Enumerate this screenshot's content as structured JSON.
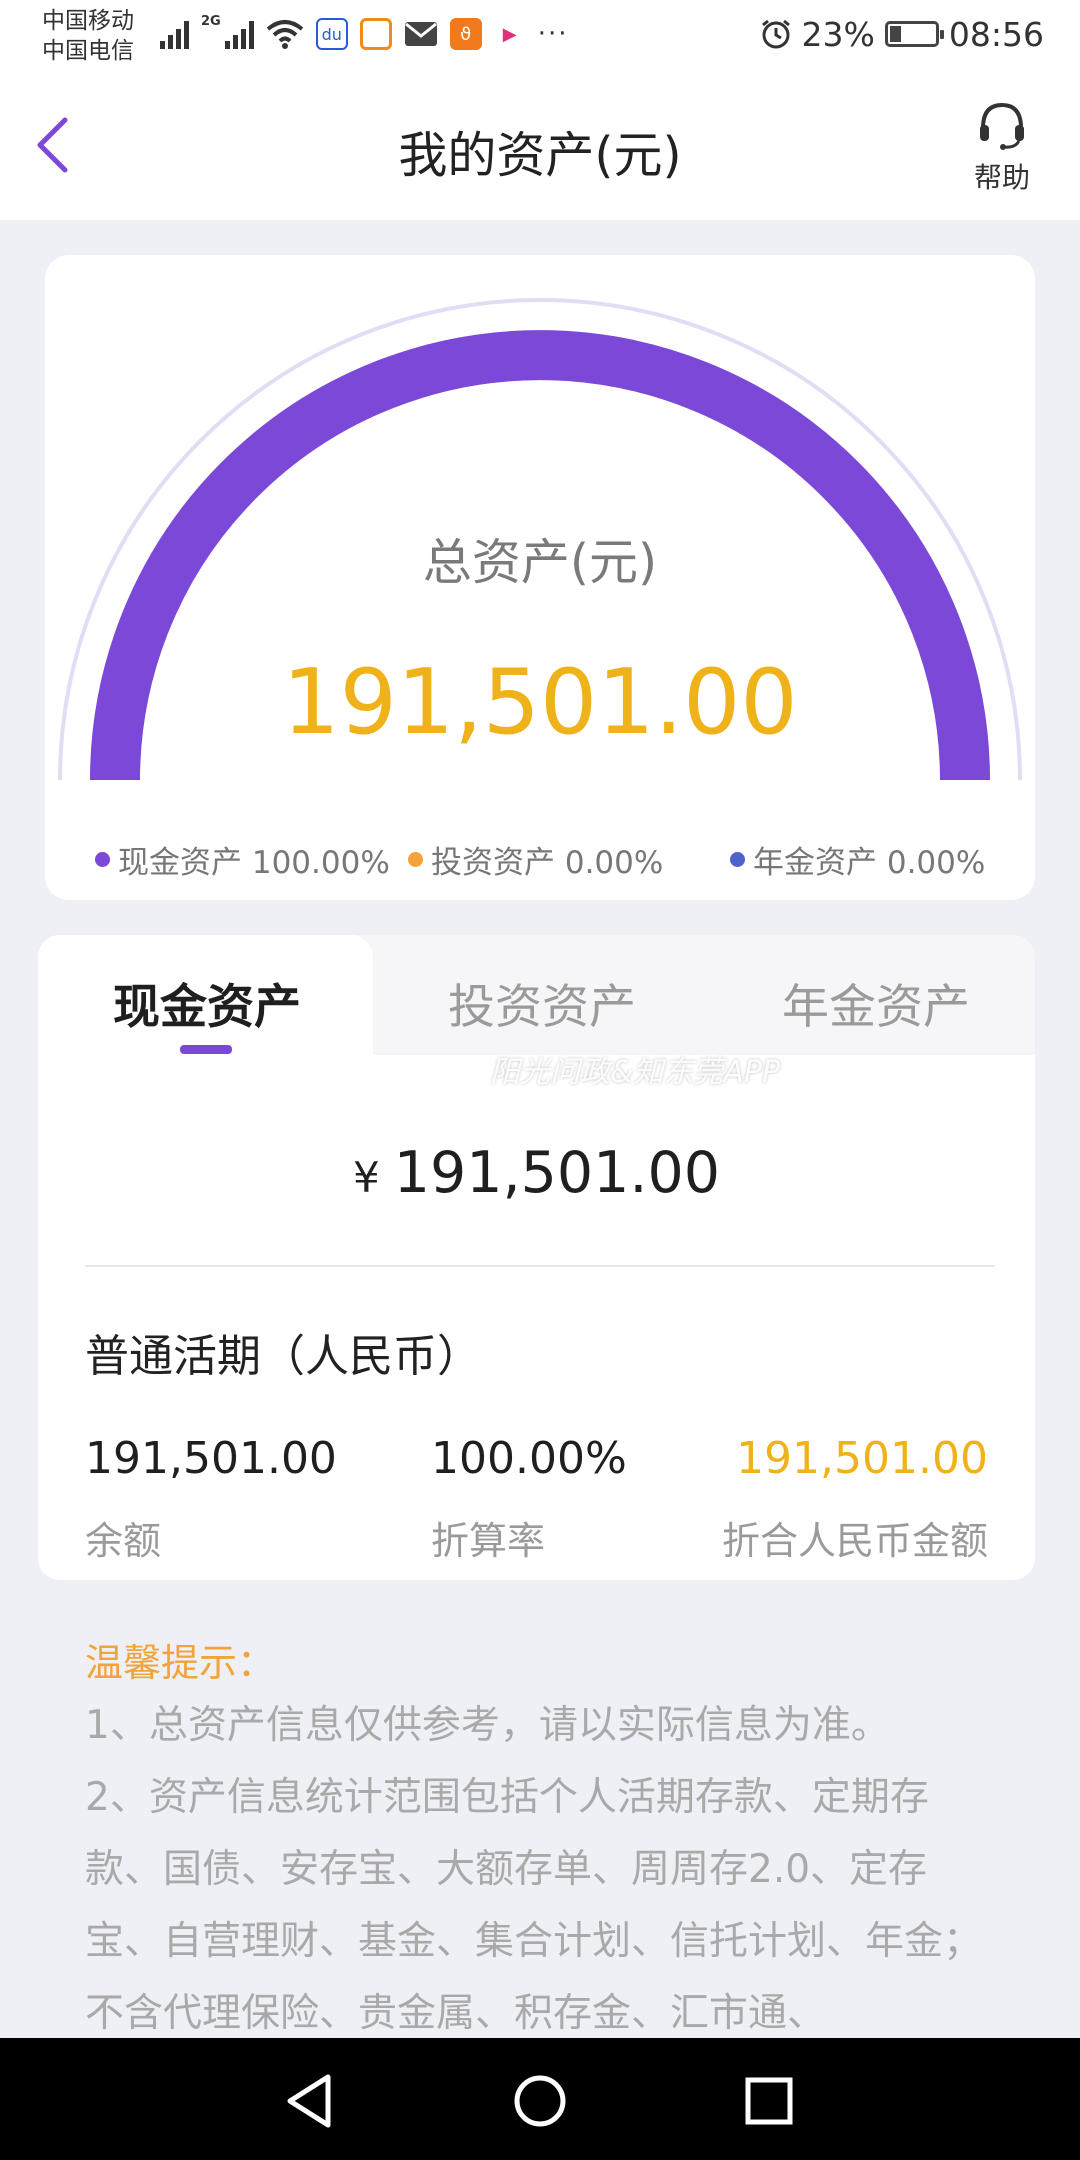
{
  "status_bar": {
    "carrier1": "中国移动",
    "carrier2": "中国电信",
    "signal_label": "2G",
    "battery": "23%",
    "time": "08:56"
  },
  "header": {
    "title": "我的资产(元)",
    "help_label": "帮助"
  },
  "gauge": {
    "label": "总资产(元)",
    "value": "191,501.00",
    "cash_fraction": 1.0,
    "legend": [
      {
        "label": "现金资产 100.00%",
        "color": "#7c48d8"
      },
      {
        "label": "投资资产 0.00%",
        "color": "#f2a33a"
      },
      {
        "label": "年金资产 0.00%",
        "color": "#4f62c9"
      }
    ]
  },
  "tabs": [
    {
      "label": "现金资产",
      "active": true
    },
    {
      "label": "投资资产",
      "active": false
    },
    {
      "label": "年金资产",
      "active": false
    }
  ],
  "watermark": "阳光问政&知东莞APP",
  "detail": {
    "currency_symbol": "¥",
    "total": "191,501.00",
    "account_title": "普通活期（人民币）",
    "balance_value": "191,501.00",
    "balance_label": "余额",
    "rate_value": "100.00%",
    "rate_label": "折算率",
    "rmb_value": "191,501.00",
    "rmb_label": "折合人民币金额"
  },
  "tips": {
    "title": "温馨提示：",
    "lines": [
      "1、总资产信息仅供参考，请以实际信息为准。",
      "2、资产信息统计范围包括个人活期存款、定期存款、国债、安存宝、大额存单、周周存2.0、定存宝、自营理财、基金、集合计划、信托计划、年金；不含代理保险、贵金属、积存金、汇市通、"
    ]
  },
  "colors": {
    "accent": "#7c48d8",
    "gold": "#efb21a",
    "tip_orange": "#f2a33a"
  }
}
